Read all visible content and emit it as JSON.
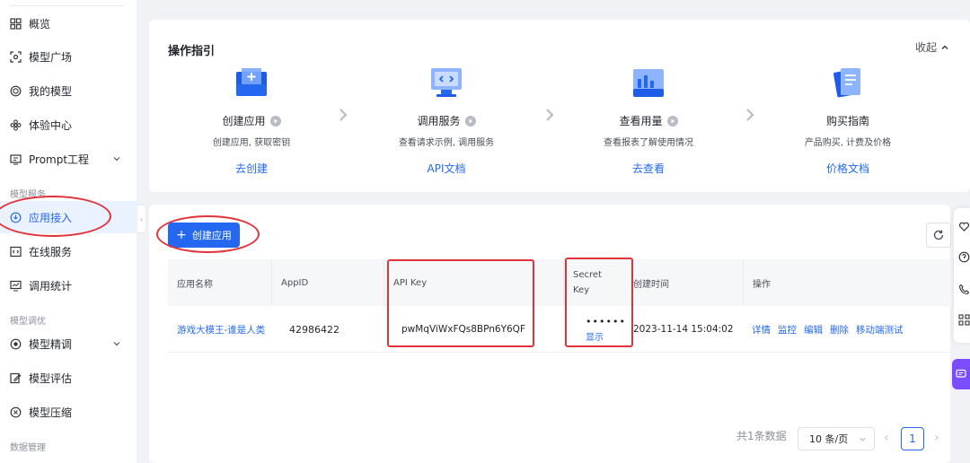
{
  "sidebar": {
    "items": [
      {
        "label": "概览",
        "icon": "grid-icon"
      },
      {
        "label": "模型广场",
        "icon": "scan-icon"
      },
      {
        "label": "我的模型",
        "icon": "cube-icon"
      },
      {
        "label": "体验中心",
        "icon": "flower-icon"
      },
      {
        "label": "Prompt工程",
        "icon": "prompt-icon"
      },
      {
        "label": "应用接入",
        "icon": "shield-icon"
      },
      {
        "label": "在线服务",
        "icon": "code-icon"
      },
      {
        "label": "调用统计",
        "icon": "monitor-icon"
      },
      {
        "label": "模型精调",
        "icon": "target-icon"
      },
      {
        "label": "模型评估",
        "icon": "edit-icon"
      },
      {
        "label": "模型压缩",
        "icon": "compress-icon"
      }
    ],
    "groups": {
      "service": "模型服务",
      "tune": "模型调优",
      "data": "数据管理"
    },
    "active_color": "#2468f2"
  },
  "guide": {
    "title": "操作指引",
    "collapse_label": "收起",
    "steps": [
      {
        "name": "创建应用",
        "desc": "创建应用, 获取密钥",
        "link": "去创建",
        "icon": "create-app-icon"
      },
      {
        "name": "调用服务",
        "desc": "查看请求示例, 调用服务",
        "link": "API文档",
        "icon": "monitor-code-icon"
      },
      {
        "name": "查看用量",
        "desc": "查看报表了解使用情况",
        "link": "去查看",
        "icon": "chart-icon"
      },
      {
        "name": "购买指南",
        "desc": "产品购买, 计费及价格",
        "link": "价格文档",
        "icon": "document-icon"
      }
    ]
  },
  "apps": {
    "create_label": "创建应用",
    "columns": [
      "应用名称",
      "AppID",
      "API Key",
      "Secret Key",
      "创建时间",
      "操作"
    ],
    "row": {
      "name": "游戏大模王-谁是人类",
      "appid": "42986422",
      "api_key": "pwMqViWxFQs8BPn6Y6QF",
      "secret_mask": "••••••",
      "secret_show": "显示",
      "created": "2023-11-14 15:04:02",
      "ops": [
        "详情",
        "监控",
        "编辑",
        "删除",
        "移动端测试"
      ]
    },
    "pagination": {
      "total": "共1条数据",
      "page_size": "10 条/页",
      "current": "1"
    }
  },
  "colors": {
    "primary": "#2468f2",
    "annotation": "#e0333a",
    "chat": "#7b4dff"
  }
}
